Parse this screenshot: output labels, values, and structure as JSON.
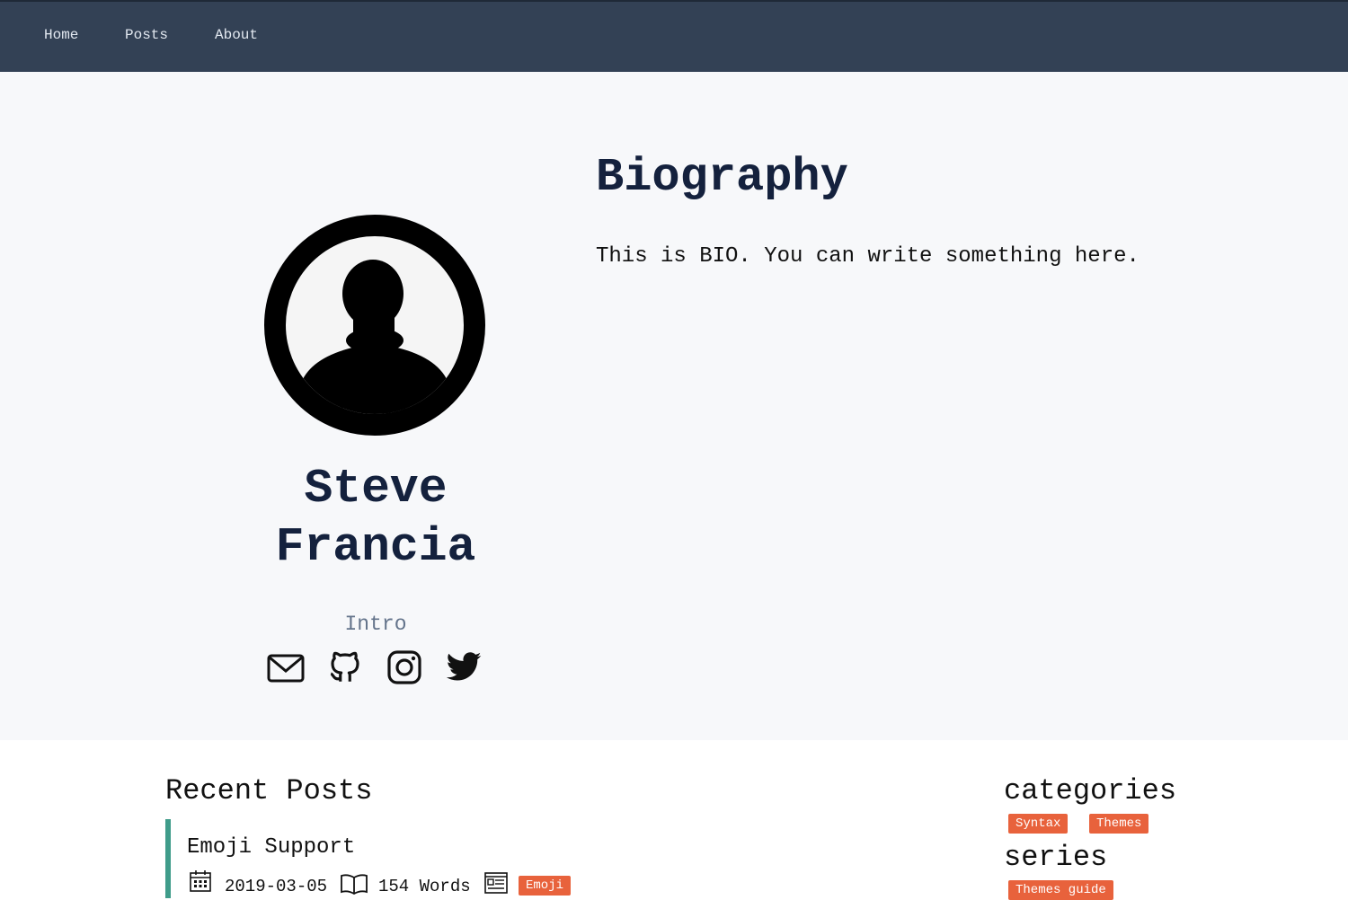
{
  "nav": {
    "items": [
      "Home",
      "Posts",
      "About"
    ]
  },
  "profile": {
    "name_line1": "Steve",
    "name_line2": "Francia",
    "intro": "Intro",
    "social_icons": [
      "email-icon",
      "github-icon",
      "instagram-icon",
      "twitter-icon"
    ]
  },
  "bio": {
    "title": "Biography",
    "text": "This is BIO. You can write something here."
  },
  "recent_posts": {
    "title": "Recent Posts",
    "posts": [
      {
        "title": "Emoji Support",
        "date": "2019-03-05",
        "word_count": "154 Words",
        "tag": "Emoji"
      }
    ]
  },
  "sidebar": {
    "categories_title": "categories",
    "categories": [
      "Syntax",
      "Themes"
    ],
    "series_title": "series",
    "series": [
      "Themes guide"
    ]
  },
  "colors": {
    "navbar": "#334155",
    "hero_bg": "#f7f8fa",
    "heading": "#14213d",
    "tag": "#e8623c",
    "post_accent": "#3f9c8a"
  }
}
